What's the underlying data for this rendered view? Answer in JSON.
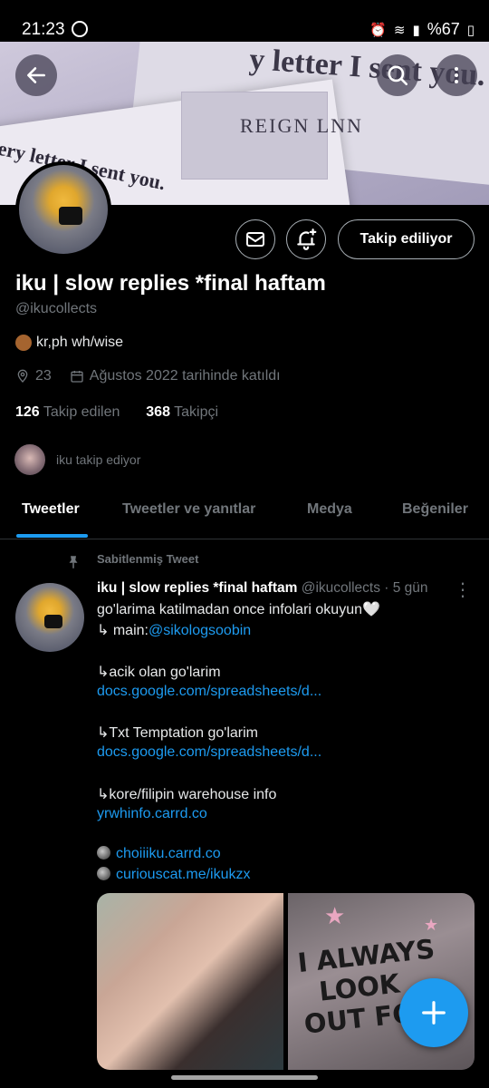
{
  "status_bar": {
    "time": "21:23",
    "battery": "%67"
  },
  "banner": {
    "line1": "y letter I sent you.",
    "line2": "REIGN LNN",
    "line3": "ery letter I sent you."
  },
  "profile": {
    "display_name": "iku | slow replies *final haftam",
    "handle": "@ikucollects",
    "bio": "kr,ph wh/wise",
    "location": "23",
    "joined": "Ağustos 2022 tarihinde katıldı",
    "following_count": "126",
    "following_label": "Takip edilen",
    "followers_count": "368",
    "followers_label": "Takipçi",
    "followed_by": "iku takip ediyor",
    "follow_button": "Takip ediliyor"
  },
  "tabs": [
    {
      "label": "Tweetler",
      "active": true
    },
    {
      "label": "Tweetler ve yanıtlar",
      "active": false
    },
    {
      "label": "Medya",
      "active": false
    },
    {
      "label": "Beğeniler",
      "active": false
    }
  ],
  "tweet": {
    "pinned_label": "Sabitlenmiş Tweet",
    "name": "iku | slow replies *final haftam",
    "handle": "@ikucollects",
    "time": "· 5 gün",
    "lines": {
      "l1": "go'larima katilmadan once infolari okuyun🤍",
      "l2_prefix": " ↳ main:",
      "l2_link": "@sikologsoobin",
      "l3": "↳acik olan go'larim",
      "l4": "docs.google.com/spreadsheets/d...",
      "l5": "↳Txt Temptation go'larim",
      "l6": "docs.google.com/spreadsheets/d...",
      "l7": "↳kore/filipin warehouse info",
      "l8": "yrwhinfo.carrd.co",
      "l9": "choiiiku.carrd.co",
      "l10": "curiouscat.me/ikukzx"
    },
    "media2_text": "I ALWAYS\n  LOOK\nOUT FOR"
  },
  "colors": {
    "accent": "#1d9bf0",
    "muted": "#71767b",
    "background": "#000000"
  }
}
